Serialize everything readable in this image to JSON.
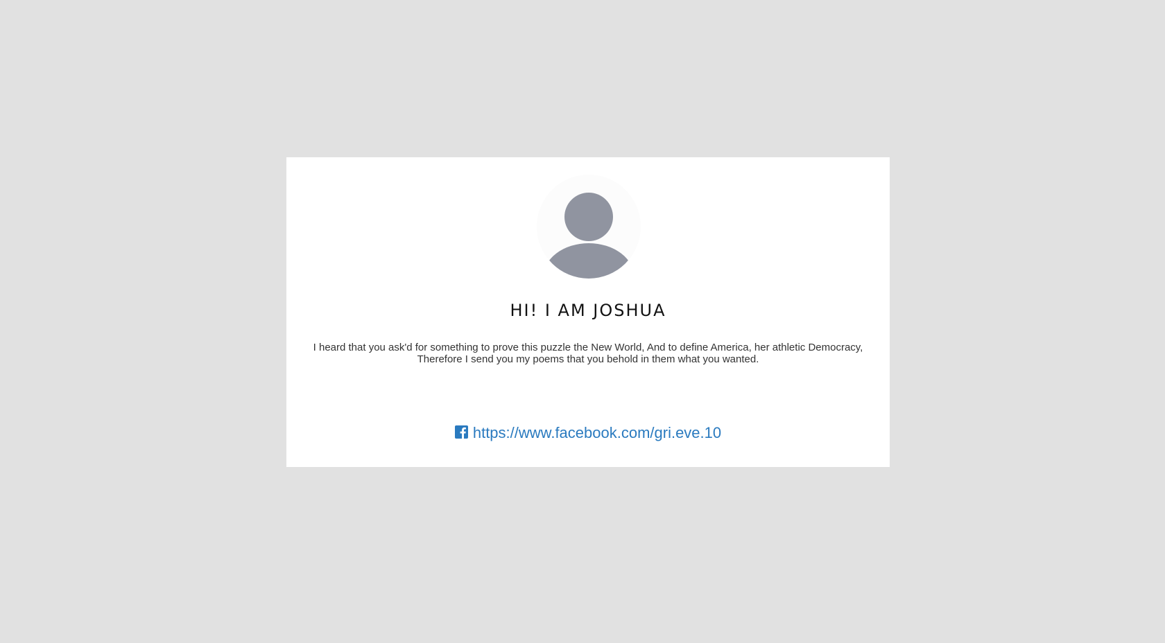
{
  "profile": {
    "avatar_icon": "user-silhouette-icon",
    "title": "HI! I AM JOSHUA",
    "bio": "I heard that you ask'd for something to prove this puzzle the New World, And to define America, her athletic Democracy, Therefore I send you my poems that you behold in them what you wanted."
  },
  "social": {
    "icon": "facebook-icon",
    "link_text": "https://www.facebook.com/gri.eve.10",
    "link_href": "https://www.facebook.com/gri.eve.10"
  },
  "colors": {
    "background": "#e1e1e1",
    "card": "#ffffff",
    "avatar_silhouette": "#9094a0",
    "link": "#2a7abf"
  }
}
